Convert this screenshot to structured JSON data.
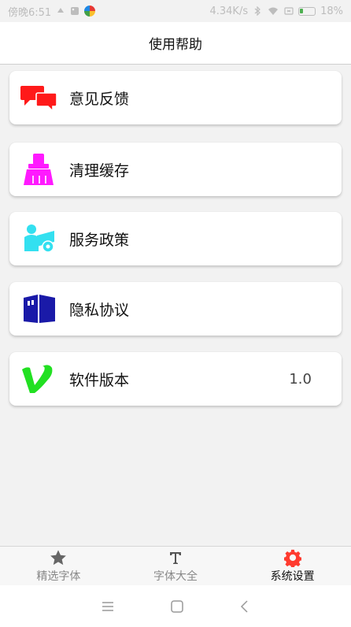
{
  "status_bar": {
    "time": "傍晚6:51",
    "network_speed": "4.34K/s",
    "battery_percent": "18%"
  },
  "header": {
    "title": "使用帮助"
  },
  "menu": {
    "items": [
      {
        "label": "意见反馈",
        "icon": "chat-bubbles-icon",
        "color": "#ff1a1a"
      },
      {
        "label": "清理缓存",
        "icon": "broom-icon",
        "color": "#ff1aff"
      },
      {
        "label": "服务政策",
        "icon": "service-policy-icon",
        "color": "#33e0f0"
      },
      {
        "label": "隐私协议",
        "icon": "privacy-book-icon",
        "color": "#1a1aa8"
      },
      {
        "label": "软件版本",
        "icon": "version-v-icon",
        "color": "#22e022",
        "value": "1.0"
      }
    ]
  },
  "bottom_nav": {
    "tabs": [
      {
        "label": "精选字体",
        "icon": "star-icon",
        "active": false
      },
      {
        "label": "字体大全",
        "icon": "text-t-icon",
        "active": false
      },
      {
        "label": "系统设置",
        "icon": "gear-icon",
        "active": true
      }
    ],
    "active_color": "#ff3b2f"
  }
}
